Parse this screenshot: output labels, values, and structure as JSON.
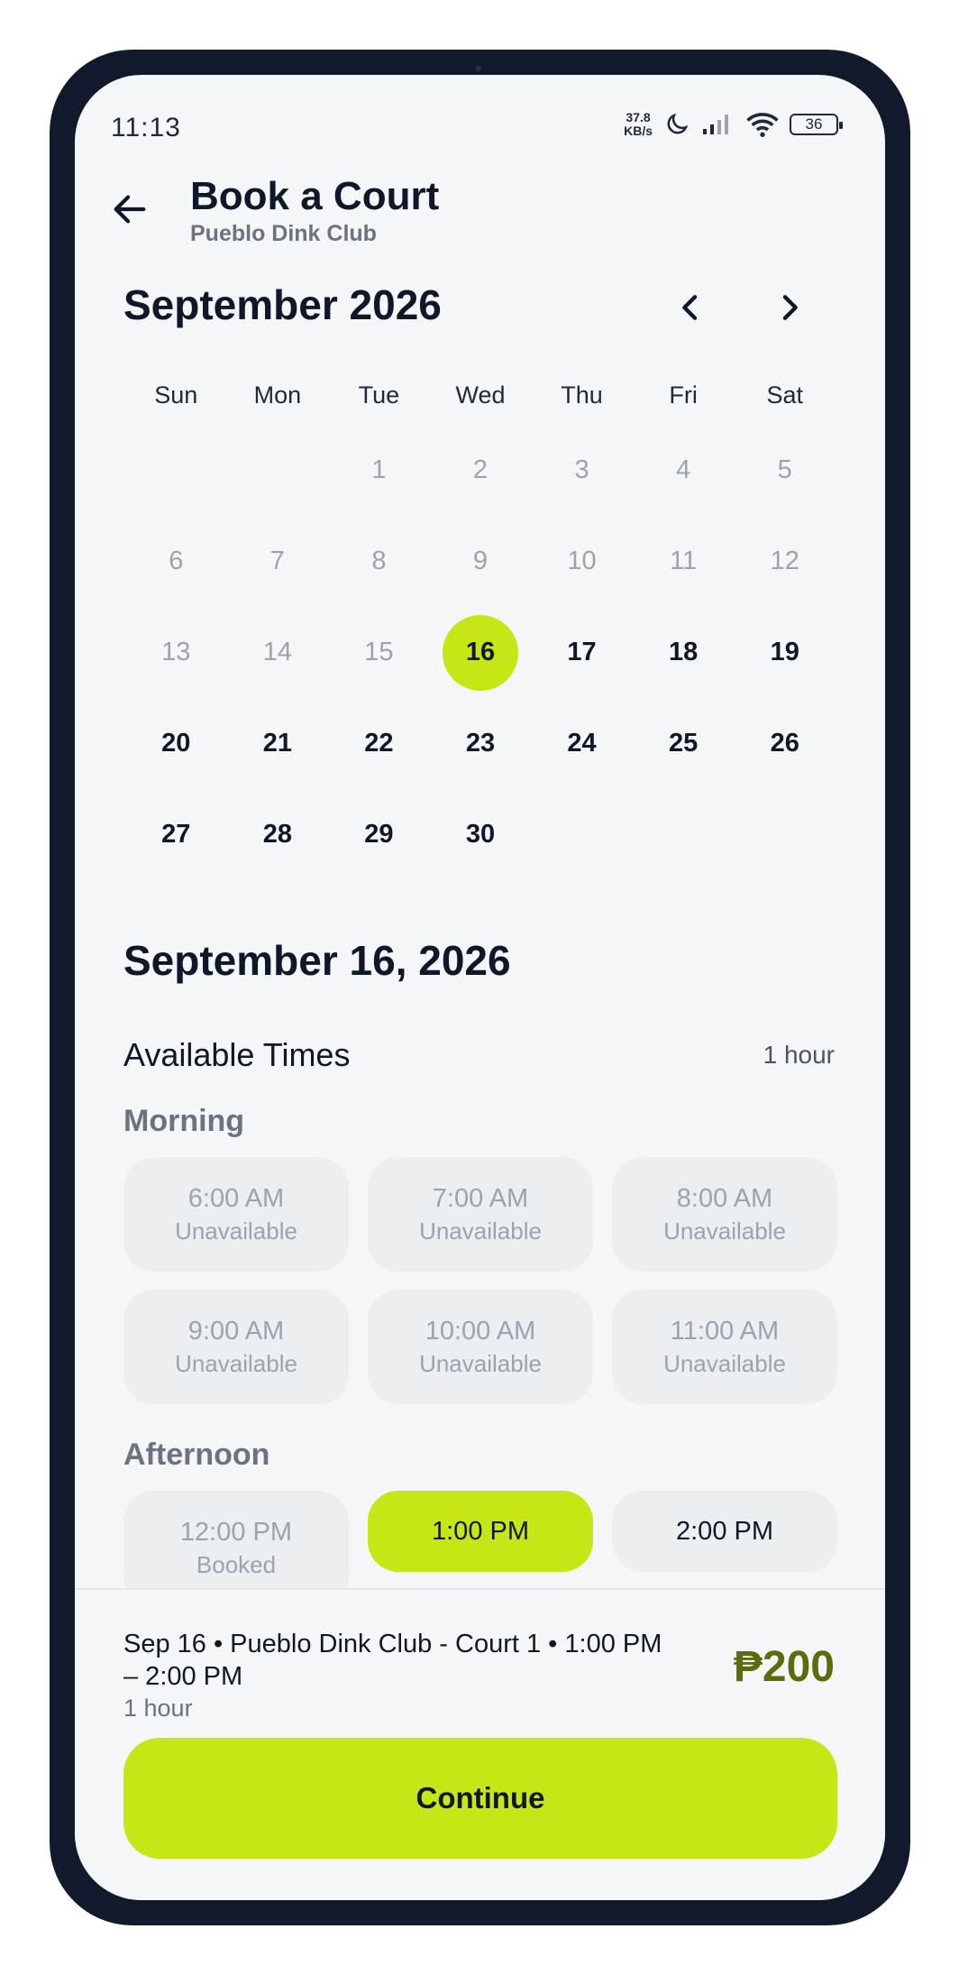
{
  "status_bar": {
    "time": "11:13",
    "net_speed_value": "37.8",
    "net_speed_unit": "KB/s",
    "battery": "36",
    "icons": [
      "moon-icon",
      "signal-icon",
      "wifi-icon",
      "battery-icon"
    ]
  },
  "header": {
    "title": "Book a Court",
    "subtitle": "Pueblo Dink Club",
    "back_icon": "arrow-left-icon"
  },
  "calendar": {
    "month_title": "September 2026",
    "prev_icon": "chevron-left-icon",
    "next_icon": "chevron-right-icon",
    "weekdays": [
      "Sun",
      "Mon",
      "Tue",
      "Wed",
      "Thu",
      "Fri",
      "Sat"
    ],
    "days": [
      {
        "n": "",
        "state": "empty"
      },
      {
        "n": "",
        "state": "empty"
      },
      {
        "n": "1",
        "state": "muted"
      },
      {
        "n": "2",
        "state": "muted"
      },
      {
        "n": "3",
        "state": "muted"
      },
      {
        "n": "4",
        "state": "muted"
      },
      {
        "n": "5",
        "state": "muted"
      },
      {
        "n": "6",
        "state": "muted"
      },
      {
        "n": "7",
        "state": "muted"
      },
      {
        "n": "8",
        "state": "muted"
      },
      {
        "n": "9",
        "state": "muted"
      },
      {
        "n": "10",
        "state": "muted"
      },
      {
        "n": "11",
        "state": "muted"
      },
      {
        "n": "12",
        "state": "muted"
      },
      {
        "n": "13",
        "state": "muted"
      },
      {
        "n": "14",
        "state": "muted"
      },
      {
        "n": "15",
        "state": "muted"
      },
      {
        "n": "16",
        "state": "selected"
      },
      {
        "n": "17",
        "state": "active"
      },
      {
        "n": "18",
        "state": "active"
      },
      {
        "n": "19",
        "state": "active"
      },
      {
        "n": "20",
        "state": "active"
      },
      {
        "n": "21",
        "state": "active"
      },
      {
        "n": "22",
        "state": "active"
      },
      {
        "n": "23",
        "state": "active"
      },
      {
        "n": "24",
        "state": "active"
      },
      {
        "n": "25",
        "state": "active"
      },
      {
        "n": "26",
        "state": "active"
      },
      {
        "n": "27",
        "state": "active"
      },
      {
        "n": "28",
        "state": "active"
      },
      {
        "n": "29",
        "state": "active"
      },
      {
        "n": "30",
        "state": "active"
      }
    ],
    "accent_color": "#c7e615"
  },
  "times": {
    "date_heading": "September 16, 2026",
    "available_label": "Available Times",
    "duration": "1 hour",
    "morning_label": "Morning",
    "afternoon_label": "Afternoon",
    "morning_slots": [
      {
        "time": "6:00 AM",
        "state": "Unavailable"
      },
      {
        "time": "7:00 AM",
        "state": "Unavailable"
      },
      {
        "time": "8:00 AM",
        "state": "Unavailable"
      },
      {
        "time": "9:00 AM",
        "state": "Unavailable"
      },
      {
        "time": "10:00 AM",
        "state": "Unavailable"
      },
      {
        "time": "11:00 AM",
        "state": "Unavailable"
      }
    ],
    "afternoon_slots": [
      {
        "time": "12:00 PM",
        "state": "Booked"
      },
      {
        "time": "1:00 PM",
        "state": "selected"
      },
      {
        "time": "2:00 PM",
        "state": "free"
      }
    ]
  },
  "summary": {
    "text": "Sep 16 • Pueblo Dink Club - Court 1 • 1:00 PM – 2:00 PM",
    "duration": "1 hour",
    "price": "₱200",
    "price_color": "#5e6b0c",
    "continue_label": "Continue"
  }
}
